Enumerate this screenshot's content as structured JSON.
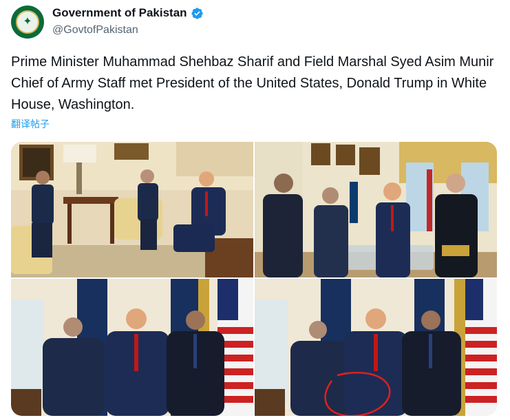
{
  "account": {
    "display_name": "Government of Pakistan",
    "handle": "@GovtofPakistan",
    "avatar_icon": "pakistan-emblem-icon",
    "verified_icon": "verified-badge-icon",
    "verified_color": "#1d9bf0"
  },
  "tweet": {
    "text": "Prime Minister Muhammad Shehbaz Sharif and Field Marshal Syed Asim Munir Chief of Army Staff met President of the United States, Donald Trump in White House, Washington.",
    "translate_label": "翻译帖子"
  },
  "media": {
    "count": 4,
    "photos": [
      {
        "name": "oval-office-seated-meeting"
      },
      {
        "name": "oval-office-standing-conversation"
      },
      {
        "name": "group-photo-flags"
      },
      {
        "name": "group-photo-flags-annotated"
      }
    ],
    "annotation_color": "#e0201c"
  }
}
